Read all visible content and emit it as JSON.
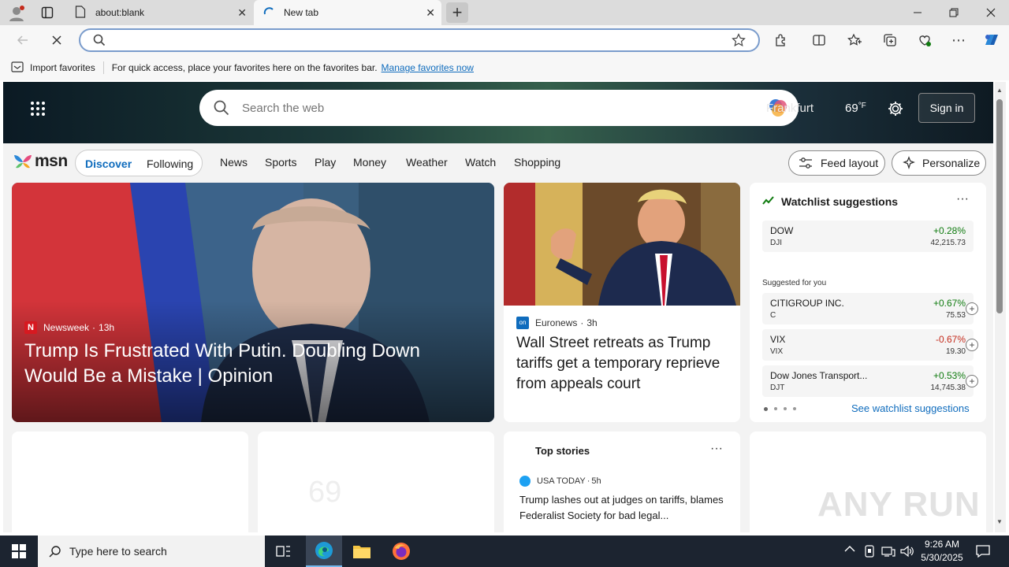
{
  "browser": {
    "tabs": [
      {
        "title": "about:blank"
      },
      {
        "title": "New tab"
      }
    ],
    "newtab_glyph": "+",
    "address": {
      "value": "",
      "placeholder": ""
    },
    "favorites_bar": {
      "import_label": "Import favorites",
      "prompt": "For quick access, place your favorites here on the favorites bar.",
      "manage_link": "Manage favorites now"
    }
  },
  "msn": {
    "search_placeholder": "Search the web",
    "location": "Frankfurt",
    "temperature": "69",
    "temp_unit": "°F",
    "sign_in": "Sign in",
    "logo_text": "msn",
    "tabs": [
      "Discover",
      "Following"
    ],
    "nav": [
      "News",
      "Sports",
      "Play",
      "Money",
      "Weather",
      "Watch",
      "Shopping"
    ],
    "feed_layout": "Feed layout",
    "personalize": "Personalize"
  },
  "main_card": {
    "source": "Newsweek",
    "age": "13h",
    "headline": "Trump Is Frustrated With Putin. Doubling Down Would Be a Mistake | Opinion"
  },
  "second_card": {
    "source": "Euronews",
    "age": "3h",
    "headline": "Wall Street retreats as Trump tariffs get a temporary reprieve from appeals court"
  },
  "watchlist": {
    "title": "Watchlist suggestions",
    "more": "···",
    "featured": {
      "name": "DOW",
      "symbol": "DJI",
      "change": "+0.28%",
      "price": "42,215.73"
    },
    "suggested_label": "Suggested for you",
    "items": [
      {
        "name": "CITIGROUP INC.",
        "symbol": "C",
        "change": "+0.67%",
        "price": "75.53",
        "color": "#0f7b0f"
      },
      {
        "name": "VIX",
        "symbol": "VIX",
        "change": "-0.67%",
        "price": "19.30",
        "color": "#c42b1c"
      },
      {
        "name": "Dow Jones Transport...",
        "symbol": "DJT",
        "change": "+0.53%",
        "price": "14,745.38",
        "color": "#0f7b0f"
      }
    ],
    "see_link": "See watchlist suggestions"
  },
  "weather_card": {
    "temp": "69"
  },
  "top_stories": {
    "title": "Top stories",
    "more": "···",
    "source": "USA TODAY",
    "age": "5h",
    "headline": "Trump lashes out at judges on tariffs, blames Federalist Society for bad legal..."
  },
  "watermark": "ANY RUN",
  "taskbar": {
    "search_placeholder": "Type here to search",
    "time": "9:26 AM",
    "date": "5/30/2025"
  },
  "colors": {
    "accent": "#0f6cbd",
    "positive": "#0f7b0f",
    "negative": "#c42b1c",
    "taskbar": "#1c2430"
  }
}
